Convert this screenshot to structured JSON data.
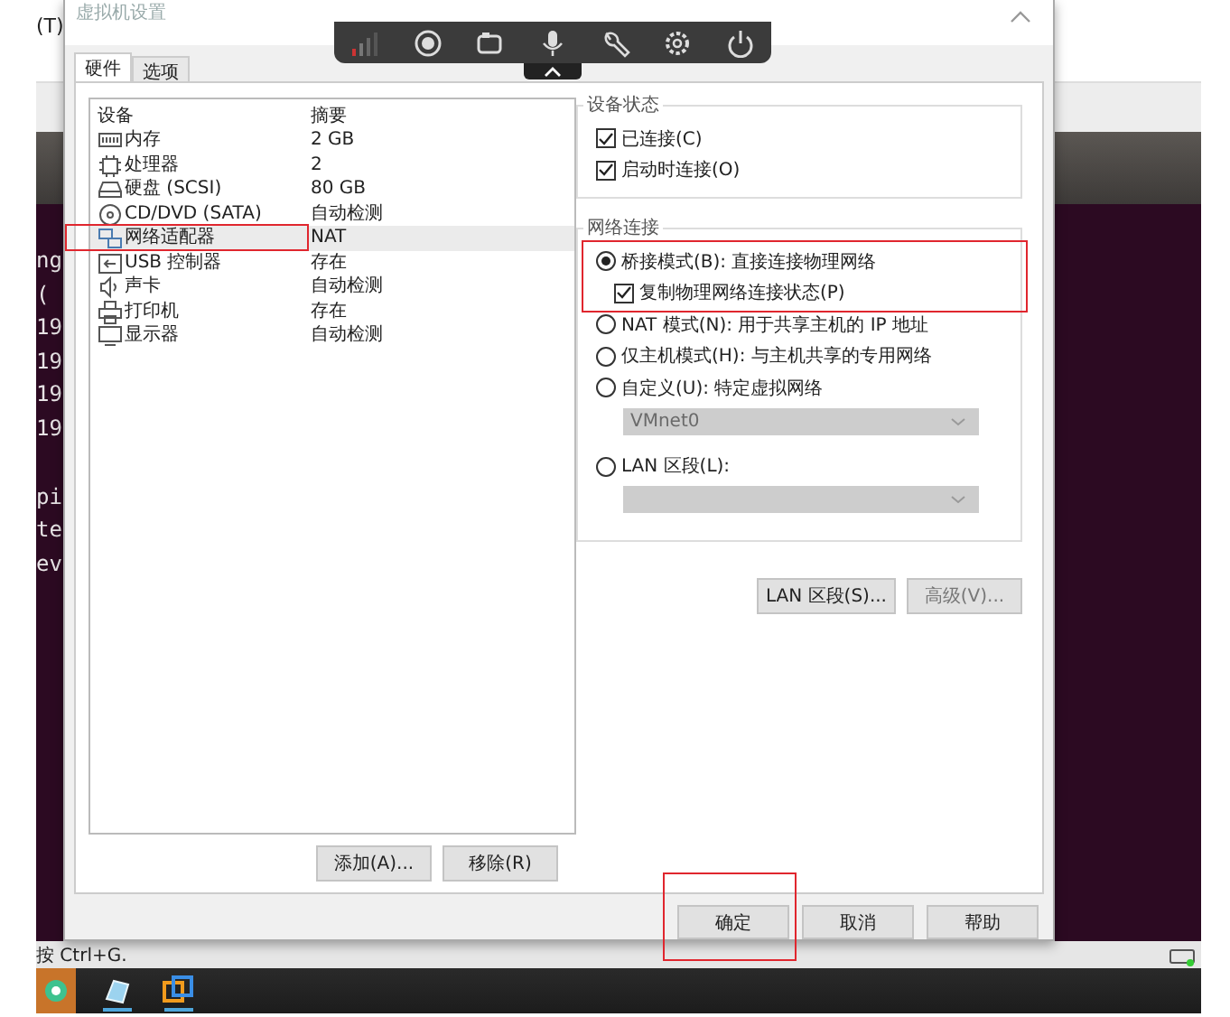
{
  "background_app": {
    "menu_fragment": "(T)",
    "terminal_blocks": [
      [
        "ng",
        "(",
        "19",
        "19",
        "19",
        "19"
      ],
      [
        "pi",
        "te",
        "ev"
      ]
    ],
    "status_text": "按 Ctrl+G."
  },
  "dialog": {
    "title": "虚拟机设置",
    "tabs": [
      {
        "label": "硬件",
        "selected": true
      },
      {
        "label": "选项",
        "selected": false
      }
    ],
    "device_table": {
      "columns": [
        "设备",
        "摘要"
      ],
      "rows": [
        {
          "device": "内存",
          "summary": "2 GB",
          "selected": false
        },
        {
          "device": "处理器",
          "summary": "2",
          "selected": false
        },
        {
          "device": "硬盘 (SCSI)",
          "summary": "80 GB",
          "selected": false
        },
        {
          "device": "CD/DVD (SATA)",
          "summary": "自动检测",
          "selected": false
        },
        {
          "device": "网络适配器",
          "summary": "NAT",
          "selected": true,
          "annotated": true
        },
        {
          "device": "USB 控制器",
          "summary": "存在",
          "selected": false
        },
        {
          "device": "声卡",
          "summary": "自动检测",
          "selected": false
        },
        {
          "device": "打印机",
          "summary": "存在",
          "selected": false
        },
        {
          "device": "显示器",
          "summary": "自动检测",
          "selected": false
        }
      ]
    },
    "device_buttons": [
      "添加(A)...",
      "移除(R)"
    ],
    "device_status": {
      "title": "设备状态",
      "options": [
        {
          "label": "已连接(C)",
          "checked": true
        },
        {
          "label": "启动时连接(O)",
          "checked": true
        }
      ]
    },
    "network": {
      "title": "网络连接",
      "options": [
        {
          "kind": "radio",
          "label": "桥接模式(B): 直接连接物理网络",
          "selected": true,
          "annotated": true
        },
        {
          "kind": "checkbox",
          "label": "复制物理网络连接状态(P)",
          "checked": true,
          "annotated": true
        },
        {
          "kind": "radio",
          "label": "NAT 模式(N): 用于共享主机的 IP 地址",
          "selected": false
        },
        {
          "kind": "radio",
          "label": "仅主机模式(H): 与主机共享的专用网络",
          "selected": false
        },
        {
          "kind": "radio",
          "label": "自定义(U): 特定虚拟网络",
          "selected": false
        },
        {
          "kind": "select",
          "value": "VMnet0",
          "disabled": true
        },
        {
          "kind": "radio",
          "label": "LAN 区段(L):",
          "selected": false
        },
        {
          "kind": "select",
          "disabled": true
        }
      ],
      "buttons": [
        {
          "label": "LAN 区段(S)...",
          "disabled": false
        },
        {
          "label": "高级(V)...",
          "disabled": true
        }
      ]
    },
    "footer_buttons": [
      {
        "label": "确定",
        "annotated": true
      },
      {
        "label": "取消"
      },
      {
        "label": "帮助"
      }
    ]
  }
}
